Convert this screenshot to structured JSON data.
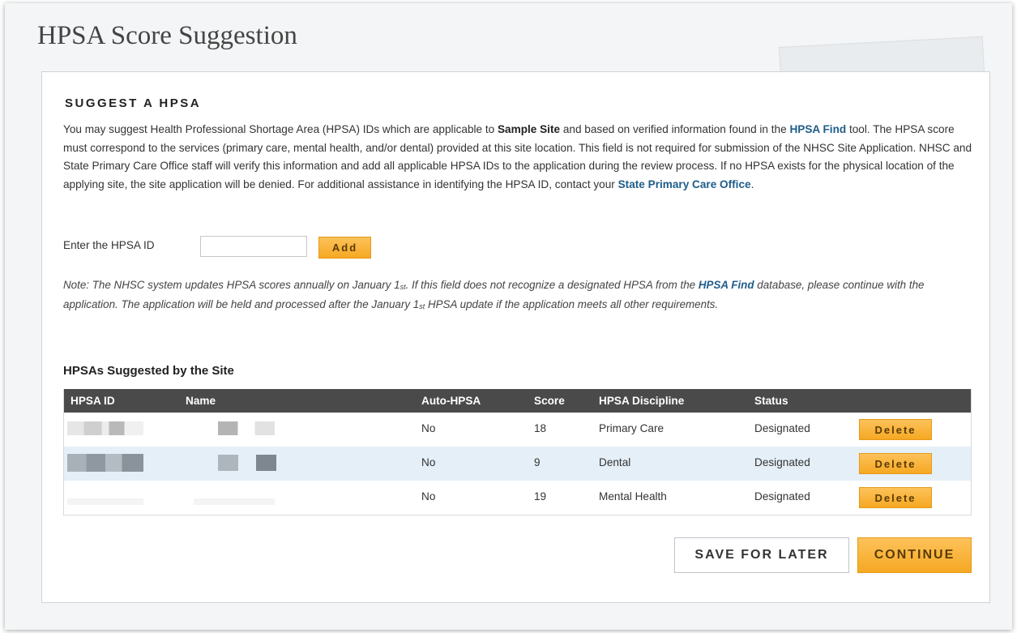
{
  "page": {
    "title": "HPSA Score Suggestion"
  },
  "section": {
    "heading": "SUGGEST A HPSA",
    "intro": {
      "p1": "You may suggest Health Professional Shortage Area (HPSA) IDs which are applicable to ",
      "site": "Sample Site",
      "p2": " and based on verified information found in the ",
      "hpsa_find_link": "HPSA Find",
      "p3": " tool. The HPSA score must correspond to the services (primary care, mental health, and/or dental) provided at this site location. This field is not required for submission of the NHSC Site Application. NHSC and State Primary Care Office staff will verify this information and add all applicable HPSA IDs to the application during the review process. If no HPSA exists for the physical location of the applying site, the site application will be denied. For additional assistance in identifying the HPSA ID, contact your ",
      "state_office_link": "State Primary Care Office",
      "p4": "."
    }
  },
  "hpsa_input": {
    "label": "Enter the HPSA ID",
    "value": "",
    "placeholder": "",
    "add_label": "Add"
  },
  "note": {
    "p1": "Note: The NHSC system updates HPSA scores annually on January 1",
    "st1": "st",
    "p2": ". If this field does not recognize a designated HPSA from the ",
    "link": "HPSA Find",
    "p3": " database, please continue with the application. The application will be held and processed after the January 1",
    "st2": "st",
    "p4": " HPSA update if the application meets all other requirements."
  },
  "table": {
    "title": "HPSAs Suggested by the Site",
    "headers": {
      "id": "HPSA ID",
      "name": "Name",
      "auto": "Auto-HPSA",
      "score": "Score",
      "discipline": "HPSA Discipline",
      "status": "Status"
    },
    "rows": [
      {
        "auto": "No",
        "score": "18",
        "discipline": "Primary Care",
        "status": "Designated",
        "delete_label": "Delete"
      },
      {
        "auto": "No",
        "score": "9",
        "discipline": "Dental",
        "status": "Designated",
        "delete_label": "Delete"
      },
      {
        "auto": "No",
        "score": "19",
        "discipline": "Mental Health",
        "status": "Designated",
        "delete_label": "Delete"
      }
    ]
  },
  "actions": {
    "save_label": "SAVE FOR LATER",
    "continue_label": "CONTINUE"
  },
  "colors": {
    "accent": "#f6a823",
    "link": "#1f5d8a",
    "header_bg": "#4a4a4a",
    "alt_row": "#e5eff7"
  },
  "icons": {
    "redaction": "redacted-block"
  }
}
